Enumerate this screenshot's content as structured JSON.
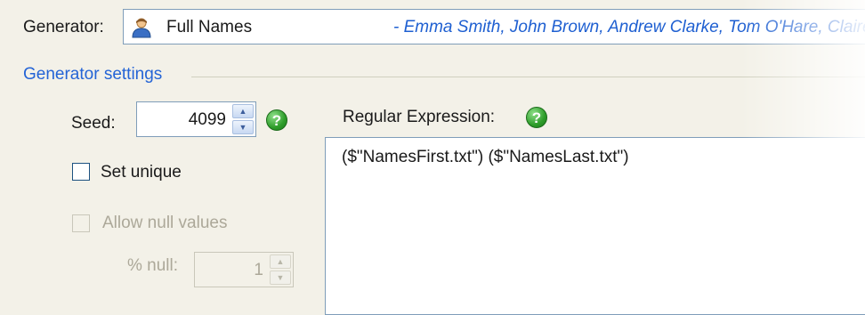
{
  "generator": {
    "label": "Generator:",
    "selected_name": "Full Names",
    "examples": "- Emma Smith, John Brown, Andrew Clarke, Tom O'Hare, Claire Ha"
  },
  "settings": {
    "section_title": "Generator settings",
    "seed_label": "Seed:",
    "seed_value": "4099",
    "set_unique_label": "Set unique",
    "set_unique_checked": false,
    "allow_null_label": "Allow null values",
    "allow_null_checked": false,
    "percent_null_label": "% null:",
    "percent_null_value": "1",
    "regex_label": "Regular Expression:",
    "regex_value": "($\"NamesFirst.txt\") ($\"NamesLast.txt\")",
    "help_glyph": "?"
  },
  "colors": {
    "section_title": "#2464d6",
    "example_text": "#1e5fd1",
    "background": "#f3f1e8",
    "help_icon": "#2e9d2a"
  },
  "icons": {
    "generator": "person-icon",
    "help": "help-icon"
  }
}
